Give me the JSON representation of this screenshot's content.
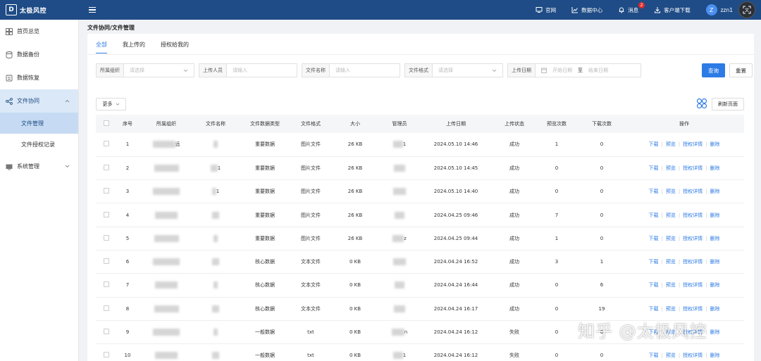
{
  "header": {
    "logo_text": "太极风控",
    "nav": [
      {
        "label": "官网",
        "icon": "monitor-icon"
      },
      {
        "label": "数据中心",
        "icon": "chart-icon"
      },
      {
        "label": "消息",
        "icon": "bell-icon",
        "badge": "2"
      },
      {
        "label": "客户端下载",
        "icon": "download-icon"
      }
    ],
    "avatar_initial": "Z",
    "username": "zzn1"
  },
  "sidebar": {
    "items": [
      {
        "label": "首页总览",
        "icon": "dashboard-icon"
      },
      {
        "label": "数据备份",
        "icon": "database-icon"
      },
      {
        "label": "数据恢复",
        "icon": "restore-icon"
      },
      {
        "label": "文件协同",
        "icon": "share-icon",
        "sub": [
          "文件管理",
          "文件授权记录"
        ]
      },
      {
        "label": "系统管理",
        "icon": "system-icon"
      }
    ]
  },
  "page": {
    "title": "文件协同/文件管理",
    "tabs": [
      "全部",
      "我上传的",
      "授权给我的"
    ],
    "filters": {
      "org_label": "所属组织",
      "org_placeholder": "请选择",
      "uploader_label": "上传人员",
      "uploader_placeholder": "请输入",
      "filename_label": "文件名称",
      "filename_placeholder": "请输入",
      "format_label": "文件格式",
      "format_placeholder": "请选择",
      "date_label": "上传日期",
      "date_start": "开始日期",
      "date_sep": "至",
      "date_end": "结束日期"
    },
    "search_label": "查询",
    "reset_label": "重置",
    "more_label": "更多",
    "refresh_label": "刷新页面"
  },
  "table": {
    "columns": [
      "序号",
      "所属组织",
      "文件名称",
      "文件数据类型",
      "文件格式",
      "大小",
      "管理员",
      "上传日期",
      "上传状态",
      "预览次数",
      "下载次数",
      "操作"
    ],
    "ops": [
      "下载",
      "预览",
      "授权详情",
      "删除"
    ],
    "rows": [
      {
        "no": "1",
        "org_hint": "远",
        "name_hint": "",
        "type": "重要数据",
        "format": "图片文件",
        "size": "26 KB",
        "admin_hint": "1",
        "date": "2024.05.10 14:46",
        "status": "成功",
        "previews": "1",
        "downloads": "0"
      },
      {
        "no": "2",
        "org_hint": "",
        "name_hint": "1",
        "type": "重要数据",
        "format": "图片文件",
        "size": "26 KB",
        "admin_hint": "",
        "date": "2024.05.10 14:45",
        "status": "成功",
        "previews": "0",
        "downloads": "0"
      },
      {
        "no": "3",
        "org_hint": "",
        "name_hint": "1",
        "type": "重要数据",
        "format": "图片文件",
        "size": "26 KB",
        "admin_hint": "",
        "date": "2024.05.10 14:40",
        "status": "成功",
        "previews": "0",
        "downloads": "0"
      },
      {
        "no": "4",
        "org_hint": "",
        "name_hint": "",
        "type": "重要数据",
        "format": "图片文件",
        "size": "26 KB",
        "admin_hint": "",
        "date": "2024.04.25 09:46",
        "status": "成功",
        "previews": "7",
        "downloads": "0"
      },
      {
        "no": "5",
        "org_hint": "",
        "name_hint": "",
        "type": "重要数据",
        "format": "图片文件",
        "size": "26 KB",
        "admin_hint": "z",
        "date": "2024.04.25 09:44",
        "status": "成功",
        "previews": "1",
        "downloads": "0"
      },
      {
        "no": "6",
        "org_hint": "",
        "name_hint": "",
        "type": "核心数据",
        "format": "文本文件",
        "size": "0 KB",
        "admin_hint": "",
        "date": "2024.04.24 16:52",
        "status": "成功",
        "previews": "3",
        "downloads": "1"
      },
      {
        "no": "7",
        "org_hint": "",
        "name_hint": "",
        "type": "核心数据",
        "format": "文本文件",
        "size": "0 KB",
        "admin_hint": "",
        "date": "2024.04.24 16:44",
        "status": "成功",
        "previews": "0",
        "downloads": "6"
      },
      {
        "no": "8",
        "org_hint": "",
        "name_hint": "",
        "type": "核心数据",
        "format": "文本文件",
        "size": "0 KB",
        "admin_hint": "",
        "date": "2024.04.24 16:17",
        "status": "成功",
        "previews": "0",
        "downloads": "19"
      },
      {
        "no": "9",
        "org_hint": "",
        "name_hint": "",
        "type": "一般数据",
        "format": "txt",
        "size": "0 KB",
        "admin_hint": "n",
        "date": "2024.04.24 16:12",
        "status": "失败",
        "previews": "0",
        "downloads": "0"
      },
      {
        "no": "10",
        "org_hint": "",
        "name_hint": "",
        "type": "一般数据",
        "format": "txt",
        "size": "0 KB",
        "admin_hint": "1",
        "date": "2024.04.24 16:12",
        "status": "失败",
        "previews": "0",
        "downloads": "0"
      }
    ]
  },
  "watermark": "知乎 @太极风控",
  "colors": {
    "header": "#1f4c86",
    "primary": "#2d7be5",
    "active_bg": "#dbe8f7"
  }
}
